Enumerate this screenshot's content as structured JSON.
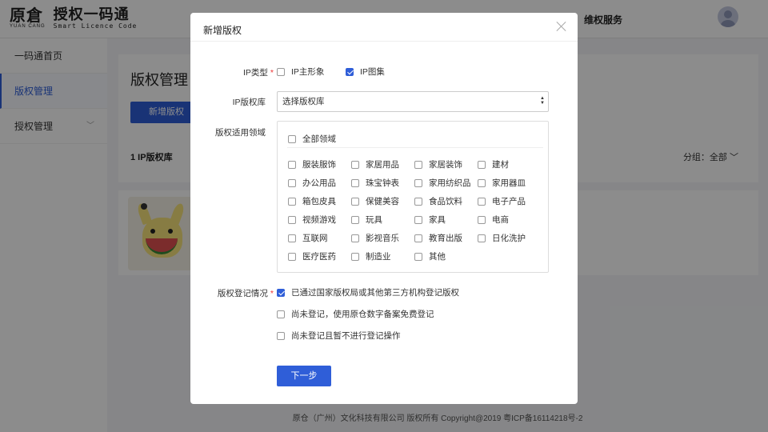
{
  "header": {
    "logo_mark": "原倉",
    "logo_sub": "YUAN CANG",
    "logo_title": "授权一码通",
    "logo_subtitle": "Smart Licence Code",
    "nav_service": "维权服务"
  },
  "sidebar": {
    "items": [
      {
        "label": "一码通首页"
      },
      {
        "label": "版权管理"
      },
      {
        "label": "授权管理"
      }
    ]
  },
  "main": {
    "title": "版权管理",
    "add_button": "新增版权",
    "count": "1 IP版权库",
    "group_label": "分组：全部"
  },
  "footer": {
    "text": "原仓（广州）文化科技有限公司 版权所有 Copyright@2019 粤ICP备16114218号-2"
  },
  "modal": {
    "title": "新增版权",
    "ip_type": {
      "label": "IP类型",
      "options": [
        {
          "label": "IP主形象",
          "checked": false
        },
        {
          "label": "IP图集",
          "checked": true
        }
      ]
    },
    "ip_library": {
      "label": "IP版权库",
      "selected": "选择版权库"
    },
    "domains": {
      "label": "版权适用领域",
      "all_label": "全部领域",
      "items": [
        "服装服饰",
        "家居用品",
        "家居装饰",
        "建材",
        "办公用品",
        "珠宝钟表",
        "家用纺织品",
        "家用器皿",
        "箱包皮具",
        "保健美容",
        "食品饮料",
        "电子产品",
        "视频游戏",
        "玩具",
        "家具",
        "电商",
        "互联网",
        "影视音乐",
        "教育出版",
        "日化洗护",
        "医疗医药",
        "制造业",
        "其他"
      ]
    },
    "registration": {
      "label": "版权登记情况",
      "options": [
        {
          "label": "已通过国家版权局或其他第三方机构登记版权",
          "checked": true
        },
        {
          "label": "尚未登记，使用原仓数字备案免费登记",
          "checked": false
        },
        {
          "label": "尚未登记且暂不进行登记操作",
          "checked": false
        }
      ]
    },
    "next_button": "下一步"
  }
}
